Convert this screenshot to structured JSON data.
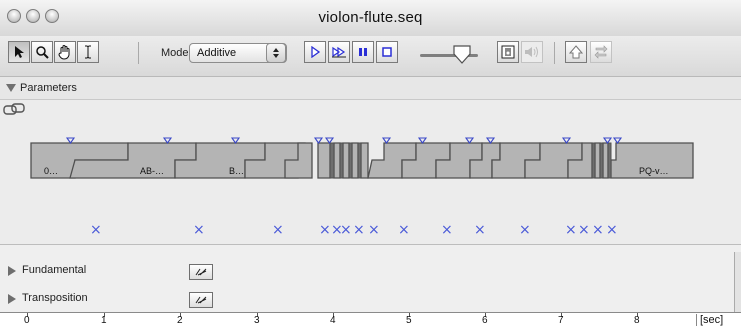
{
  "window": {
    "title": "violon-flute.seq"
  },
  "toolbar": {
    "tools": [
      "arrow-tool",
      "zoom-tool",
      "hand-tool",
      "text-cursor-tool"
    ],
    "mode_label": "Mode",
    "mode_value": "Additive",
    "transport": [
      "play",
      "play-sections",
      "pause",
      "stop"
    ]
  },
  "parameters": {
    "label": "Parameters"
  },
  "sequence": {
    "segment_labels": [
      "0…",
      "AB-…",
      "B…",
      "PQ-v…"
    ],
    "marker_glyph": "×"
  },
  "tracks": [
    {
      "label": "Fundamental"
    },
    {
      "label": "Transposition"
    }
  ],
  "ruler": {
    "ticks": [
      "0",
      "1",
      "2",
      "3",
      "4",
      "5",
      "6",
      "7",
      "8"
    ],
    "unit": "[sec]"
  },
  "colors": {
    "marker": "#4a5ad8",
    "segment_fill": "#b4b4b4",
    "segment_stroke": "#4f4f4f"
  }
}
